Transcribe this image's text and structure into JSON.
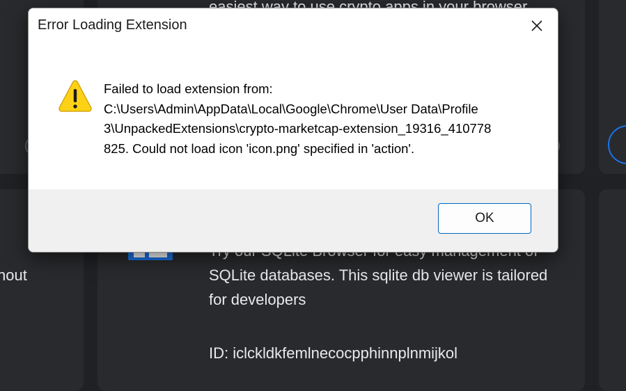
{
  "background": {
    "top_card_description": "easiest way to use crypto apps in your browser",
    "left_card_fragment": "hout",
    "sqlite_card": {
      "description_lines": [
        "Try our SQLite Browser for easy management of",
        "SQLite databases. This sqlite db viewer is tailored",
        "for developers"
      ],
      "id_line": "ID: iclckldkfemlnecocpphinnplnmijkol"
    },
    "colors": {
      "page_bg": "#202124",
      "card_bg": "#292a2d",
      "accent": "#1a73e8"
    }
  },
  "dialog": {
    "title": "Error Loading Extension",
    "close_icon": "close-icon",
    "warning_icon": "warning-icon",
    "message_lines": [
      "Failed to load extension from:",
      "C:\\Users\\Admin\\AppData\\Local\\Google\\Chrome\\User Data\\Profile",
      "3\\UnpackedExtensions\\crypto-marketcap-extension_19316_410778",
      "825. Could not load icon 'icon.png' specified in 'action'."
    ],
    "ok_label": "OK",
    "colors": {
      "warning_yellow": "#fcd116",
      "button_border": "#0067c0",
      "footer_bg": "#f0f0f0"
    }
  }
}
